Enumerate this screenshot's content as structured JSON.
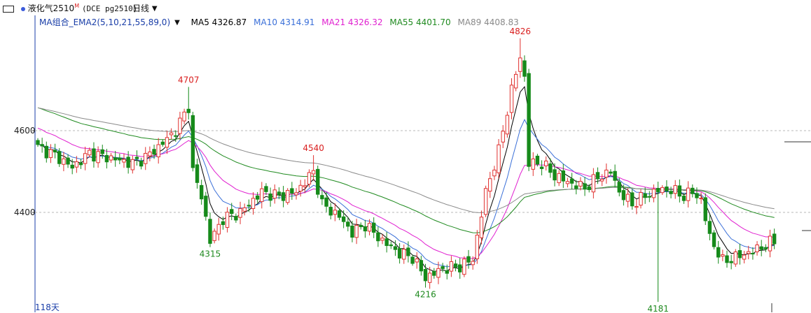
{
  "header": {
    "contract_name": "液化气2510",
    "contract_mark": "M",
    "contract_code": "(DCE pg2510)",
    "period": "日线"
  },
  "indicator": {
    "name": "MA组合_EMA2(5,10,21,55,89,0)",
    "ma5_label": "MA5 4326.87",
    "ma10_label": "MA10 4314.91",
    "ma21_label": "MA21 4326.32",
    "ma55_label": "MA55 4401.70",
    "ma89_label": "MA89 4408.83"
  },
  "colors": {
    "up": "#e0312f",
    "down": "#168a1a",
    "ma5": "#000000",
    "ma10": "#3a6fd8",
    "ma21": "#e020d0",
    "ma55": "#1f8a1f",
    "ma89": "#8a8a8a",
    "annotation_high": "#d91e1e",
    "annotation_low": "#1f8a1f"
  },
  "footer": {
    "days_label": "118天"
  },
  "chart_data": {
    "type": "candlestick",
    "y_ticks": [
      4600,
      4400
    ],
    "ylim": [
      4170,
      4850
    ],
    "annotations": [
      {
        "label": "4707",
        "value": 4707,
        "kind": "high",
        "index": 35
      },
      {
        "label": "4315",
        "value": 4315,
        "kind": "low",
        "index": 40
      },
      {
        "label": "4540",
        "value": 4540,
        "kind": "high",
        "index": 64
      },
      {
        "label": "4216",
        "value": 4216,
        "kind": "low",
        "index": 90
      },
      {
        "label": "4826",
        "value": 4826,
        "kind": "high",
        "index": 112
      },
      {
        "label": "4181",
        "value": 4181,
        "kind": "low",
        "index": 144
      }
    ],
    "anchors": [
      [
        0,
        4560
      ],
      [
        4,
        4540
      ],
      [
        8,
        4510
      ],
      [
        12,
        4545
      ],
      [
        18,
        4530
      ],
      [
        22,
        4520
      ],
      [
        25,
        4535
      ],
      [
        28,
        4560
      ],
      [
        32,
        4600
      ],
      [
        35,
        4660
      ],
      [
        36,
        4500
      ],
      [
        38,
        4440
      ],
      [
        40,
        4330
      ],
      [
        43,
        4385
      ],
      [
        47,
        4400
      ],
      [
        52,
        4450
      ],
      [
        56,
        4440
      ],
      [
        60,
        4450
      ],
      [
        64,
        4500
      ],
      [
        66,
        4420
      ],
      [
        70,
        4390
      ],
      [
        73,
        4350
      ],
      [
        76,
        4370
      ],
      [
        80,
        4330
      ],
      [
        84,
        4300
      ],
      [
        87,
        4290
      ],
      [
        90,
        4240
      ],
      [
        94,
        4262
      ],
      [
        98,
        4268
      ],
      [
        101,
        4285
      ],
      [
        104,
        4450
      ],
      [
        107,
        4550
      ],
      [
        110,
        4700
      ],
      [
        112,
        4780
      ],
      [
        113,
        4730
      ],
      [
        114,
        4520
      ],
      [
        117,
        4520
      ],
      [
        120,
        4490
      ],
      [
        124,
        4470
      ],
      [
        127,
        4460
      ],
      [
        130,
        4485
      ],
      [
        133,
        4500
      ],
      [
        135,
        4450
      ],
      [
        138,
        4420
      ],
      [
        141,
        4440
      ],
      [
        144,
        4455
      ],
      [
        147,
        4455
      ],
      [
        150,
        4440
      ],
      [
        152,
        4450
      ],
      [
        154,
        4430
      ],
      [
        156,
        4340
      ],
      [
        159,
        4280
      ],
      [
        162,
        4290
      ],
      [
        166,
        4305
      ],
      [
        169,
        4320
      ],
      [
        171,
        4330
      ]
    ]
  }
}
